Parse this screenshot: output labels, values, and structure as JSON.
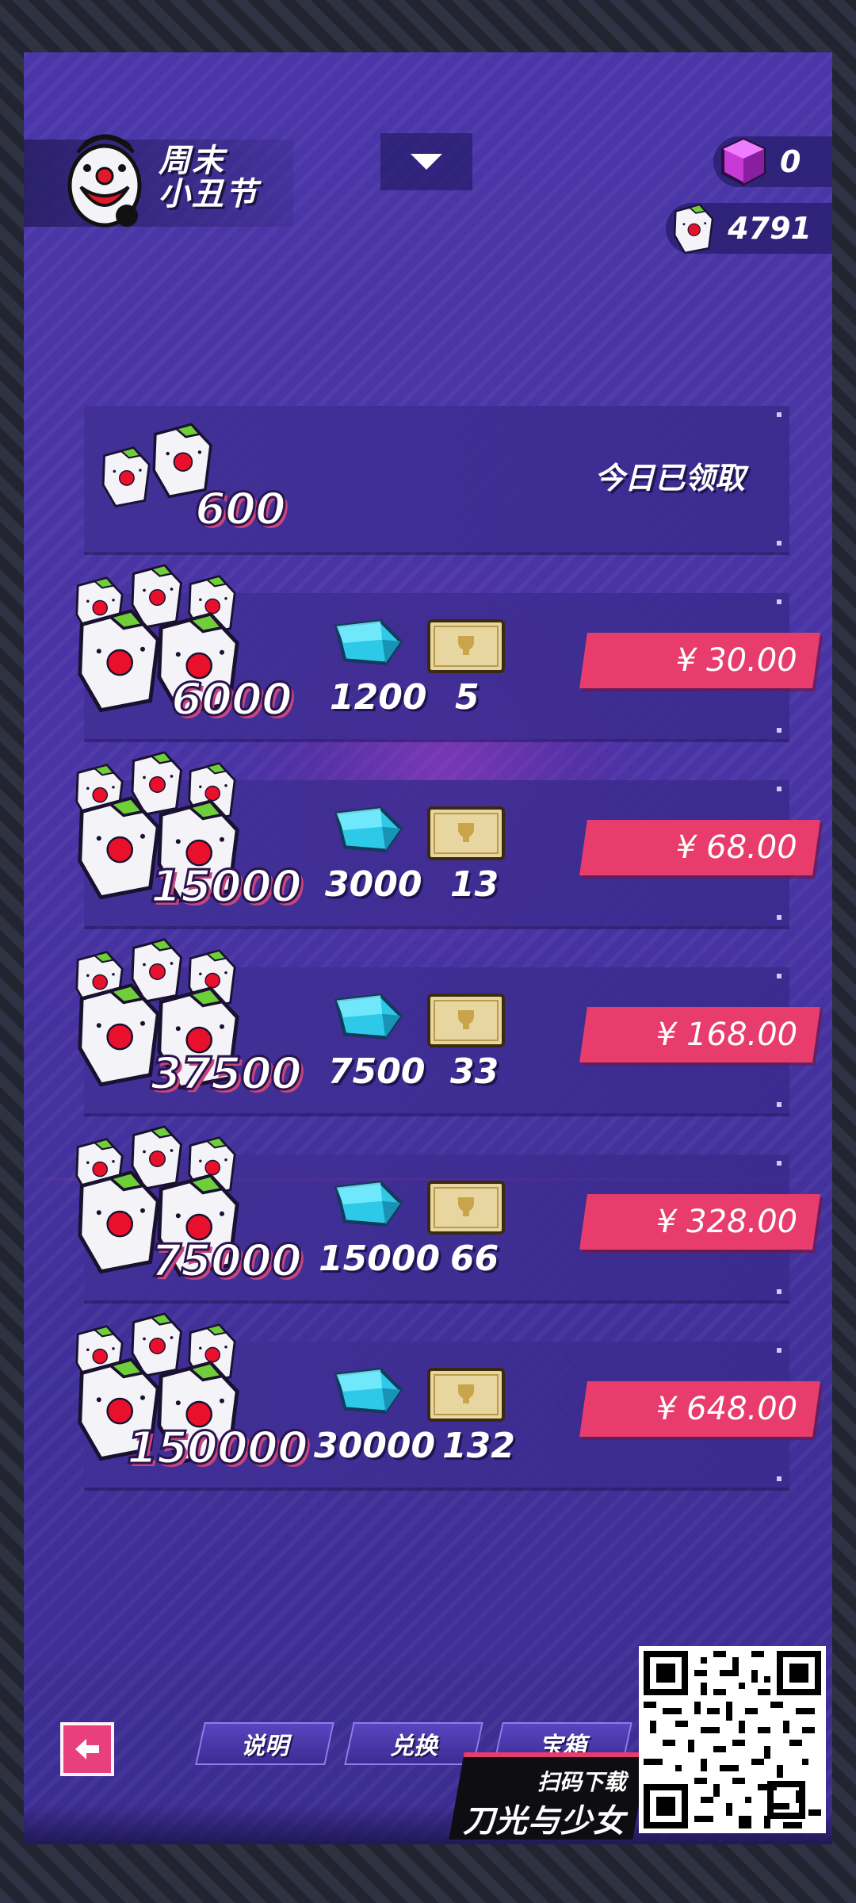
{
  "header": {
    "event_title_line1": "周末",
    "event_title_line2": "小丑节",
    "purple_currency": "0",
    "joker_currency": "4791"
  },
  "free_pack": {
    "amount": "600",
    "status": "今日已领取"
  },
  "packs": [
    {
      "amount": "6000",
      "crystals": "1200",
      "tickets": "5",
      "price": "¥ 30.00"
    },
    {
      "amount": "15000",
      "crystals": "3000",
      "tickets": "13",
      "price": "¥ 68.00"
    },
    {
      "amount": "37500",
      "crystals": "7500",
      "tickets": "33",
      "price": "¥ 168.00"
    },
    {
      "amount": "75000",
      "crystals": "15000",
      "tickets": "66",
      "price": "¥ 328.00"
    },
    {
      "amount": "150000",
      "crystals": "30000",
      "tickets": "132",
      "price": "¥ 648.00"
    }
  ],
  "footer": {
    "tabs": [
      "说明",
      "兑换",
      "宝箱"
    ],
    "promo_sub": "扫码下载",
    "promo_main": "刀光与少女"
  },
  "colors": {
    "accent_pink": "#e83d6c",
    "panel_purple": "#41309a",
    "crystal_cyan": "#2ec9e8"
  },
  "icons": [
    "joker-logo-icon",
    "chevron-down-icon",
    "purple-cube-icon",
    "joker-card-icon",
    "crystal-icon",
    "ticket-icon",
    "back-arrow-icon",
    "qr-code-icon"
  ]
}
